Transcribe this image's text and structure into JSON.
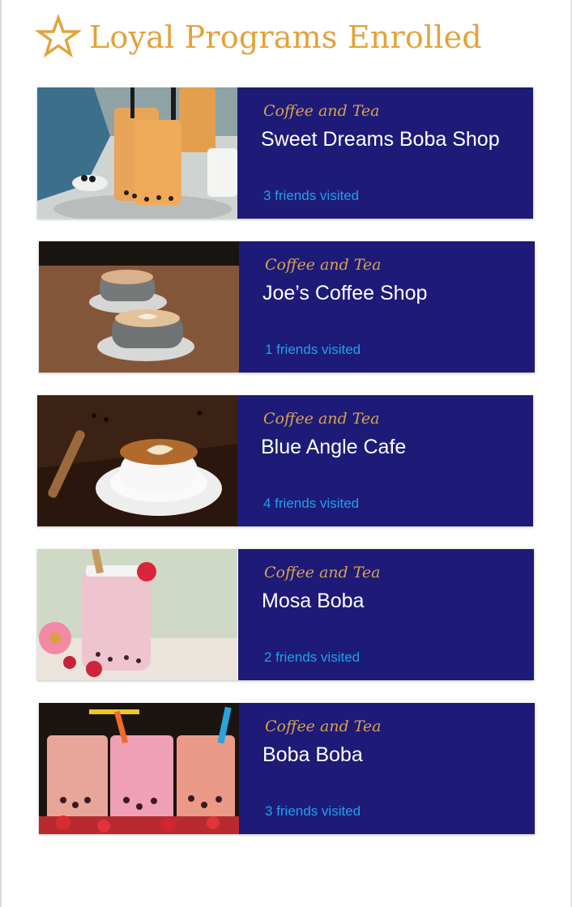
{
  "header": {
    "title": "Loyal Programs Enrolled",
    "icon": "star-outline-icon",
    "accent_color": "#e3a23a"
  },
  "theme": {
    "panel_color": "#1e1a78",
    "category_color": "#d4a450",
    "friends_color": "#1fa2e8"
  },
  "programs": [
    {
      "category": "Coffee and Tea",
      "name": "Sweet Dreams Boba Shop",
      "friends": "3 friends visited",
      "image": "boba-tea-photo"
    },
    {
      "category": "Coffee and Tea",
      "name": "Joe’s Coffee Shop",
      "friends": "1 friends visited",
      "image": "latte-cups-photo"
    },
    {
      "category": "Coffee and Tea",
      "name": "Blue Angle Cafe",
      "friends": "4 friends visited",
      "image": "latte-art-photo"
    },
    {
      "category": "Coffee and Tea",
      "name": "Mosa Boba",
      "friends": "2 friends visited",
      "image": "strawberry-boba-photo"
    },
    {
      "category": "Coffee and Tea",
      "name": "Boba Boba",
      "friends": "3 friends visited",
      "image": "fruit-boba-cups-photo"
    }
  ]
}
